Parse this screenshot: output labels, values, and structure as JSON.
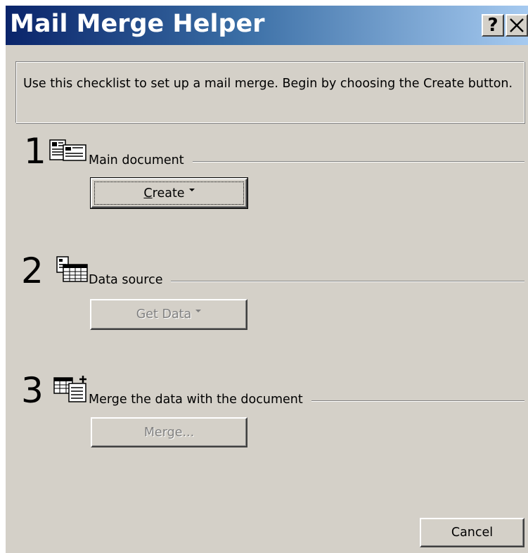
{
  "window": {
    "title": "Mail Merge Helper",
    "help_button_label": "?",
    "close_icon": "close-icon"
  },
  "instructions": "Use this checklist to set up a mail merge. Begin by choosing the Create button.",
  "steps": [
    {
      "number": "1",
      "label": "Main document",
      "icon": "main-document-icon",
      "button": {
        "label_mnemonic": "C",
        "label_rest": "reate",
        "has_dropdown": true,
        "enabled": true
      }
    },
    {
      "number": "2",
      "label": "Data source",
      "icon": "data-source-icon",
      "button": {
        "label": "Get Data",
        "has_dropdown": true,
        "enabled": false
      }
    },
    {
      "number": "3",
      "label": "Merge the data with the document",
      "icon": "merge-icon",
      "button": {
        "label": "Merge...",
        "enabled": false
      }
    }
  ],
  "footer": {
    "cancel_label": "Cancel"
  },
  "colors": {
    "face": "#d4d0c8",
    "title_start": "#0a246a",
    "title_end": "#a6caf0",
    "disabled_text": "#808080"
  }
}
